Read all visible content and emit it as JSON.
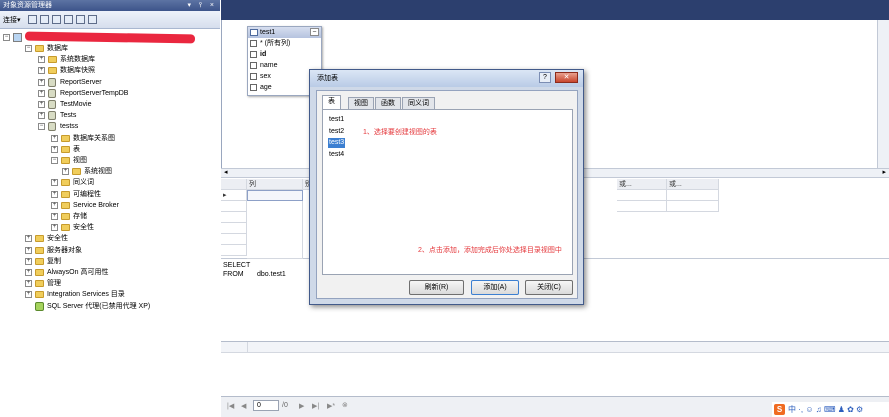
{
  "object_explorer": {
    "title": "对象资源管理器",
    "title_buttons": "▾ ⫯ ×",
    "toolbar_connect": "连接▾",
    "tree": [
      {
        "label": "数据库",
        "indent": 1,
        "exp": "⊟",
        "icon": "folder"
      },
      {
        "label": "系统数据库",
        "indent": 2,
        "exp": "⊞",
        "icon": "folder"
      },
      {
        "label": "数据库快照",
        "indent": 2,
        "exp": "⊞",
        "icon": "folder"
      },
      {
        "label": "ReportServer",
        "indent": 2,
        "exp": "⊞",
        "icon": "db"
      },
      {
        "label": "ReportServerTempDB",
        "indent": 2,
        "exp": "⊞",
        "icon": "db"
      },
      {
        "label": "TestMovie",
        "indent": 2,
        "exp": "⊞",
        "icon": "db"
      },
      {
        "label": "Tests",
        "indent": 2,
        "exp": "⊞",
        "icon": "db"
      },
      {
        "label": "testss",
        "indent": 2,
        "exp": "⊟",
        "icon": "db"
      },
      {
        "label": "数据库关系图",
        "indent": 3,
        "exp": "⊞",
        "icon": "folder"
      },
      {
        "label": "表",
        "indent": 3,
        "exp": "⊞",
        "icon": "folder"
      },
      {
        "label": "视图",
        "indent": 3,
        "exp": "⊟",
        "icon": "folder"
      },
      {
        "label": "系统视图",
        "indent": 4,
        "exp": "⊞",
        "icon": "folder"
      },
      {
        "label": "同义词",
        "indent": 3,
        "exp": "⊞",
        "icon": "folder"
      },
      {
        "label": "可编程性",
        "indent": 3,
        "exp": "⊞",
        "icon": "folder"
      },
      {
        "label": "Service Broker",
        "indent": 3,
        "exp": "⊞",
        "icon": "folder"
      },
      {
        "label": "存储",
        "indent": 3,
        "exp": "⊞",
        "icon": "folder"
      },
      {
        "label": "安全性",
        "indent": 3,
        "exp": "⊞",
        "icon": "folder"
      },
      {
        "label": "安全性",
        "indent": 1,
        "exp": "⊞",
        "icon": "folder"
      },
      {
        "label": "服务器对象",
        "indent": 1,
        "exp": "⊞",
        "icon": "folder"
      },
      {
        "label": "复制",
        "indent": 1,
        "exp": "⊞",
        "icon": "folder"
      },
      {
        "label": "AlwaysOn 高可用性",
        "indent": 1,
        "exp": "⊞",
        "icon": "folder"
      },
      {
        "label": "管理",
        "indent": 1,
        "exp": "⊞",
        "icon": "folder"
      },
      {
        "label": "Integration Services 目录",
        "indent": 1,
        "exp": "⊞",
        "icon": "folder"
      },
      {
        "label": "SQL Server 代理(已禁用代理 XP)",
        "indent": 1,
        "exp": "",
        "icon": "agent"
      }
    ]
  },
  "diagram": {
    "table_name": "test1",
    "min_label": "–",
    "columns": [
      "* (所有列)",
      "id",
      "name",
      "sex",
      "age"
    ]
  },
  "criteria": {
    "headers": [
      "列",
      "别..."
    ],
    "headers_right": [
      "或...",
      "或..."
    ]
  },
  "sql": {
    "line1_kw": "SELECT",
    "line2_kw": "FROM",
    "line2_val": "dbo.test1"
  },
  "nav": {
    "first": "|◀",
    "prev": "◀",
    "page_value": "0",
    "page_total": "/0",
    "next": "▶",
    "last": "▶|",
    "new": "▶*",
    "stop": "⊗"
  },
  "dialog": {
    "title": "添加表",
    "help": "?",
    "close": "✕",
    "tabs": [
      "表",
      "视图",
      "函数",
      "同义词"
    ],
    "items": [
      "test1",
      "test2",
      "test3",
      "test4"
    ],
    "selected_index": 2,
    "annotation1": "1、选择要创建视图的表",
    "annotation2": "2、点击添加，添加完成后你处选择目录视图中",
    "refresh_btn": "刷新(R)",
    "add_btn": "添加(A)",
    "close_btn": "关闭(C)"
  },
  "ime": {
    "logo": "S",
    "text": "中 ·, ☺ ♫ ⌨ ♟ ✿ ⚙"
  },
  "colors": {
    "accent": "#3c7fd1",
    "annotation": "#e4363a",
    "titlebar": "#2c3f6e"
  }
}
